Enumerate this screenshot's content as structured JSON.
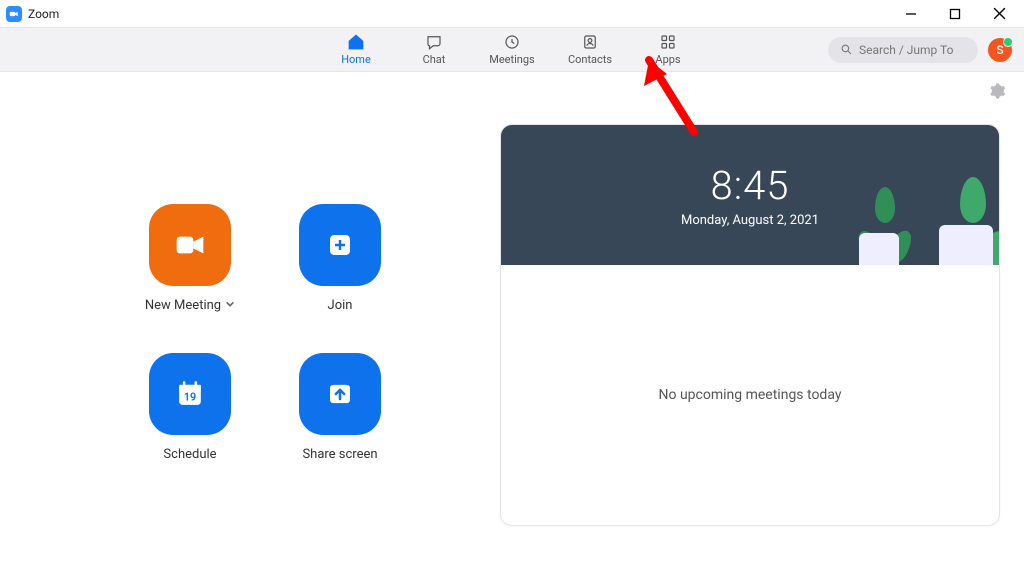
{
  "window": {
    "title": "Zoom"
  },
  "nav": {
    "tabs": [
      {
        "label": "Home"
      },
      {
        "label": "Chat"
      },
      {
        "label": "Meetings"
      },
      {
        "label": "Contacts"
      },
      {
        "label": "Apps"
      }
    ],
    "search_placeholder": "Search / Jump To",
    "avatar_initial": "S"
  },
  "actions": {
    "new_meeting": "New Meeting",
    "join": "Join",
    "schedule": "Schedule",
    "schedule_day": "19",
    "share_screen": "Share screen"
  },
  "clock": {
    "time": "8:45",
    "date": "Monday, August 2, 2021"
  },
  "upcoming": {
    "empty_text": "No upcoming meetings today"
  }
}
